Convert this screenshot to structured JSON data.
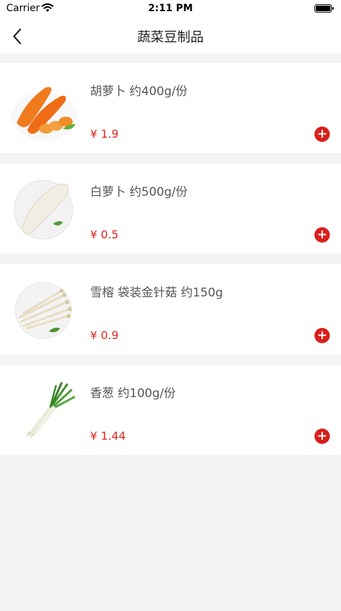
{
  "status_bar": {
    "carrier": "Carrier",
    "time": "2:11 PM"
  },
  "nav": {
    "title": "蔬菜豆制品",
    "back_icon": "chevron-left-icon"
  },
  "products": [
    {
      "name": "胡萝卜 约400g/份",
      "price": "¥ 1.9",
      "image": "carrot-image"
    },
    {
      "name": "白萝卜 约500g/份",
      "price": "¥ 0.5",
      "image": "daikon-image"
    },
    {
      "name": "雪榕 袋装金针菇 约150g",
      "price": "¥ 0.9",
      "image": "enoki-mushroom-image"
    },
    {
      "name": "香葱 约100g/份",
      "price": "¥ 1.44",
      "image": "scallion-image"
    }
  ],
  "add_button_label": "+",
  "colors": {
    "price": "#e0261d",
    "add_button": "#d91f1a",
    "background": "#f4f4f4"
  }
}
